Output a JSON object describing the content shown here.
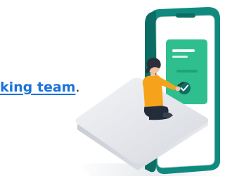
{
  "content": {
    "link_text": "king team",
    "trailing_punctuation": "."
  },
  "icons": {
    "illustration": "person-signing-on-phone-illustration",
    "checkmark": "checkmark-icon"
  },
  "colors": {
    "link": "#1a73d9",
    "phone_teal": "#0f8a7e",
    "screen_green": "#2fbf8f",
    "shirt_orange": "#f6a31b",
    "platform_gray": "#d9dde3"
  }
}
